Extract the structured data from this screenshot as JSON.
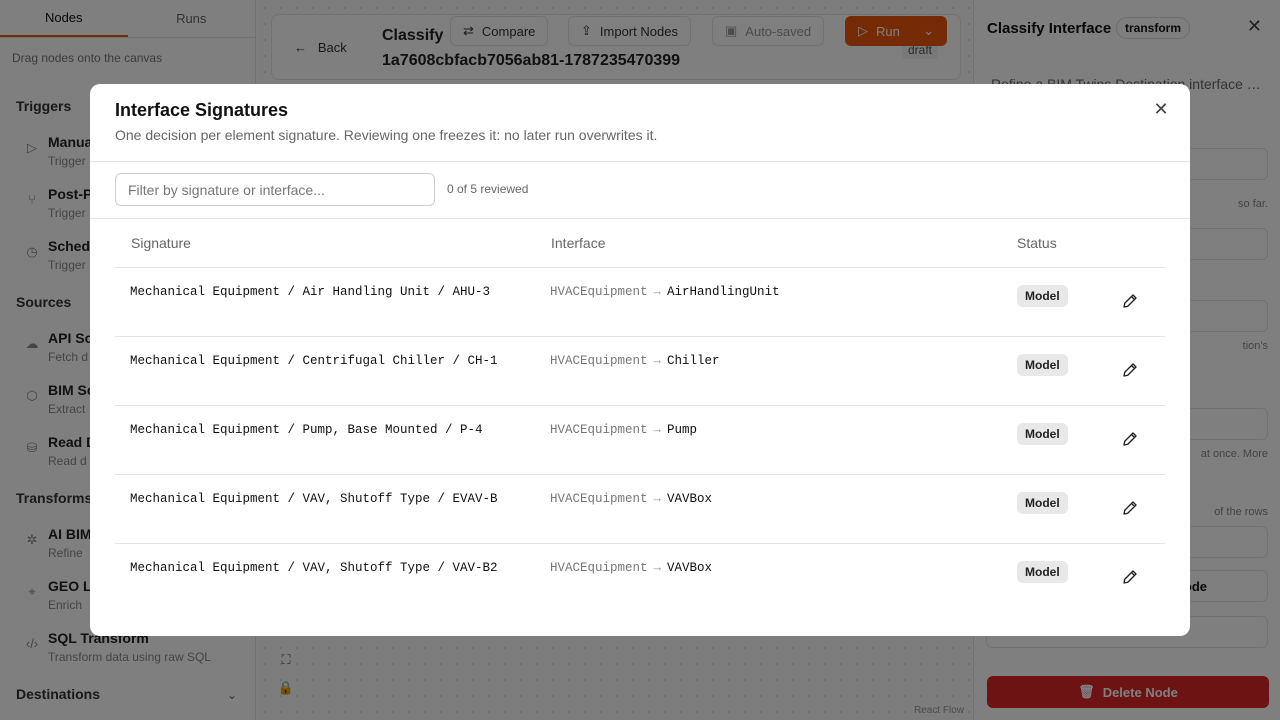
{
  "sidebar": {
    "tabs": [
      "Nodes",
      "Runs"
    ],
    "hint": "Drag nodes onto the canvas",
    "sections": {
      "triggers": "Triggers",
      "sources": "Sources",
      "transforms": "Transforms",
      "destinations": "Destinations"
    },
    "items": [
      {
        "title": "Manual",
        "desc": "Trigger"
      },
      {
        "title": "Post-P",
        "desc": "Trigger"
      },
      {
        "title": "Schedu",
        "desc": "Trigger"
      },
      {
        "title": "API So",
        "desc": "Fetch d"
      },
      {
        "title": "BIM So",
        "desc": "Extract"
      },
      {
        "title": "Read D",
        "desc": "Read d"
      },
      {
        "title": "AI BIM",
        "desc": "Refine"
      },
      {
        "title": "GEO L",
        "desc": "Enrich"
      },
      {
        "title": "SQL Transform",
        "desc": "Transform data using raw SQL"
      }
    ]
  },
  "canvas": {
    "back": "Back",
    "title": "Classify",
    "title_tail": "9",
    "id": "1a7608cbfacb7056ab81-1787235470399",
    "status": "draft",
    "toolbar": {
      "compare": "Compare",
      "import": "Import Nodes",
      "saved": "Auto-saved",
      "run": "Run"
    },
    "credit": "React Flow"
  },
  "panel": {
    "title": "Classify Interface",
    "badge": "transform",
    "desc": "Refine a BIM Twins Destination interface … ogy",
    "notes": [
      "so far.",
      "tion's",
      "at once. More",
      "of the rows"
    ],
    "node_btn": "ode",
    "delete": "Delete Node"
  },
  "modal": {
    "title": "Interface Signatures",
    "subtitle": "One decision per element signature. Reviewing one freezes it: no later run overwrites it.",
    "filter_placeholder": "Filter by signature or interface...",
    "reviewed": "0 of 5 reviewed",
    "headers": {
      "signature": "Signature",
      "interface": "Interface",
      "status": "Status"
    },
    "rows": [
      {
        "signature": "Mechanical Equipment / Air Handling Unit / AHU-3",
        "source": "HVACEquipment",
        "target": "AirHandlingUnit",
        "status": "Model"
      },
      {
        "signature": "Mechanical Equipment / Centrifugal Chiller / CH-1",
        "source": "HVACEquipment",
        "target": "Chiller",
        "status": "Model"
      },
      {
        "signature": "Mechanical Equipment / Pump, Base Mounted / P-4",
        "source": "HVACEquipment",
        "target": "Pump",
        "status": "Model"
      },
      {
        "signature": "Mechanical Equipment / VAV, Shutoff Type / EVAV-B",
        "source": "HVACEquipment",
        "target": "VAVBox",
        "status": "Model"
      },
      {
        "signature": "Mechanical Equipment / VAV, Shutoff Type / VAV-B2",
        "source": "HVACEquipment",
        "target": "VAVBox",
        "status": "Model"
      }
    ]
  }
}
